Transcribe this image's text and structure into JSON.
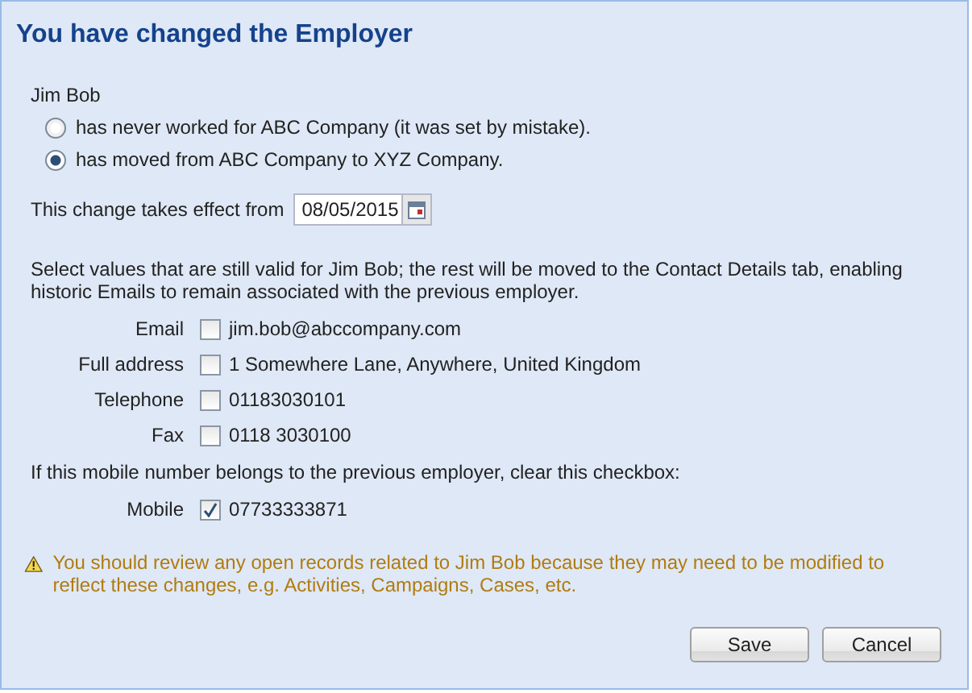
{
  "dialog": {
    "title": "You have changed the Employer"
  },
  "person": "Jim Bob",
  "options": [
    {
      "label": "has never worked for ABC Company (it was set by mistake).",
      "selected": false
    },
    {
      "label": "has moved from ABC Company to XYZ Company.",
      "selected": true
    }
  ],
  "effective_date": {
    "label": "This change takes effect from",
    "value": "08/05/2015"
  },
  "instructions": "Select values that are still valid for Jim Bob; the rest will be moved to the Contact Details tab, enabling historic Emails to remain associated with the previous employer.",
  "fields": [
    {
      "label": "Email",
      "value": "jim.bob@abccompany.com",
      "checked": false
    },
    {
      "label": "Full address",
      "value": "1 Somewhere Lane, Anywhere, United Kingdom",
      "checked": false
    },
    {
      "label": "Telephone",
      "value": "01183030101",
      "checked": false
    },
    {
      "label": "Fax",
      "value": "0118 3030100",
      "checked": false
    }
  ],
  "mobile_note": "If this mobile number belongs to the previous employer, clear this checkbox:",
  "mobile": {
    "label": "Mobile",
    "value": "07733333871",
    "checked": true
  },
  "warning": "You should review any open records related to Jim Bob because they may need to be modified to reflect these changes, e.g. Activities, Campaigns, Cases, etc.",
  "buttons": [
    "Save",
    "Cancel"
  ]
}
